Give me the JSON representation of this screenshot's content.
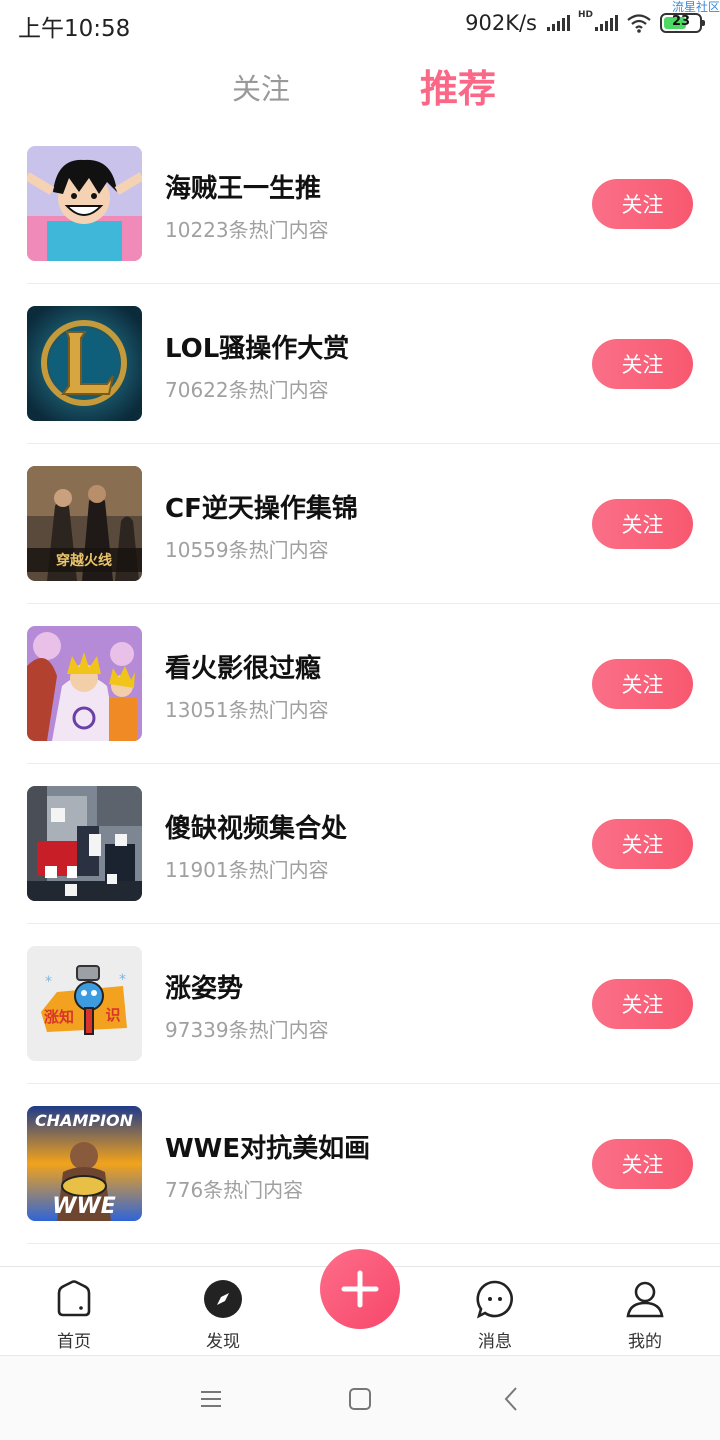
{
  "status_bar": {
    "time": "上午10:58",
    "net_speed": "902K/s",
    "hd_label": "HD",
    "battery_level": "23",
    "watermark": "流星社区",
    "battery_color": "#4cd964"
  },
  "top_tabs": {
    "follow_label": "关注",
    "recommend_label": "推荐",
    "active_color": "#fb6786"
  },
  "list": {
    "items": [
      {
        "title": "海贼王一生推",
        "subtitle": "10223条热门内容",
        "button": "关注"
      },
      {
        "title": "LOL骚操作大赏",
        "subtitle": "70622条热门内容",
        "button": "关注"
      },
      {
        "title": "CF逆天操作集锦",
        "subtitle": "10559条热门内容",
        "button": "关注"
      },
      {
        "title": "看火影很过瘾",
        "subtitle": "13051条热门内容",
        "button": "关注"
      },
      {
        "title": "傻缺视频集合处",
        "subtitle": "11901条热门内容",
        "button": "关注"
      },
      {
        "title": "涨姿势",
        "subtitle": "97339条热门内容",
        "button": "关注"
      },
      {
        "title": "WWE对抗美如画",
        "subtitle": "776条热门内容",
        "button": "关注"
      }
    ],
    "thumb_texts": {
      "cf_logo": "穿越火线",
      "zzs_left": "涨知",
      "zzs_right": "识",
      "wwe_top": "CHAMPION",
      "wwe_bottom": "WWE"
    }
  },
  "bottom_nav": {
    "home": "首页",
    "discover": "发现",
    "messages": "消息",
    "mine": "我的",
    "icons": [
      "home-icon",
      "compass-icon",
      "plus-icon",
      "chat-bubble-icon",
      "user-icon"
    ]
  },
  "system_nav": {
    "icons": [
      "menu-icon",
      "home-square-icon",
      "back-icon"
    ]
  }
}
